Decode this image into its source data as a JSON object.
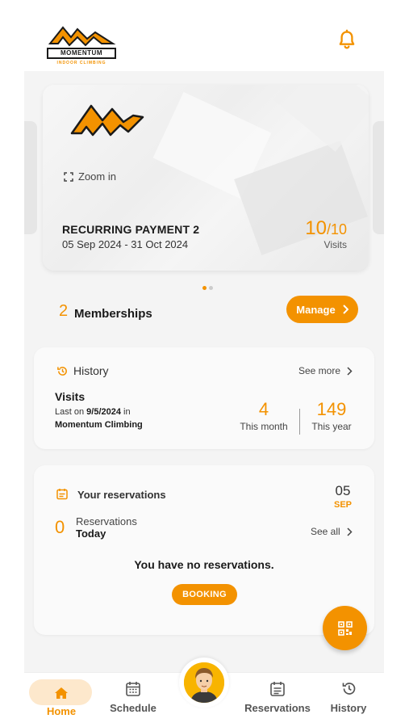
{
  "brand": {
    "name": "MOMENTUM",
    "tagline": "INDOOR CLIMBING",
    "accent_color": "#f39200"
  },
  "header": {
    "notification_icon": "bell-icon"
  },
  "membership_card": {
    "zoom_label": "Zoom in",
    "plan_name": "RECURRING PAYMENT 2",
    "dates": "05 Sep 2024 - 31 Oct 2024",
    "visits_used": "10",
    "visits_total": "/10",
    "visits_label": "Visits",
    "carousel_total": 2,
    "carousel_active": 1
  },
  "memberships": {
    "count": "2",
    "label": "Memberships",
    "manage_label": "Manage"
  },
  "history": {
    "title": "History",
    "see_more": "See more",
    "visits_title": "Visits",
    "last_on_prefix": "Last on",
    "last_on_date": "9/5/2024",
    "last_on_suffix": "in",
    "location": "Momentum Climbing",
    "month_count": "4",
    "month_label": "This month",
    "year_count": "149",
    "year_label": "This year"
  },
  "reservations": {
    "title": "Your reservations",
    "date_day": "05",
    "date_month": "SEP",
    "count": "0",
    "label_line1": "Reservations",
    "label_line2": "Today",
    "see_all": "See all",
    "empty_message": "You have no reservations.",
    "booking_label": "BOOKING"
  },
  "bottom_nav": {
    "home": "Home",
    "schedule": "Schedule",
    "reservations": "Reservations",
    "history": "History",
    "active": "home"
  }
}
